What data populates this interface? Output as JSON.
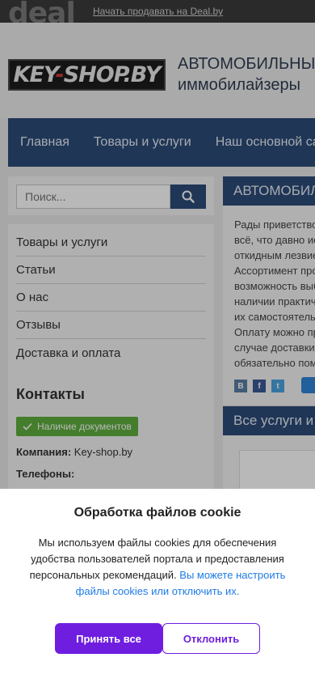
{
  "topbar": {
    "logo": "deal",
    "sell_link": "Начать продавать на Deal.by"
  },
  "header": {
    "logo_part1": "KEY",
    "logo_dash": "-",
    "logo_part2": "SHOP.BY",
    "tagline_line1": "АВТОМОБИЛЬНЫ",
    "tagline_line2": "иммобилайзеры"
  },
  "nav": [
    "Главная",
    "Товары и услуги",
    "Наш основной са"
  ],
  "search": {
    "placeholder": "Поиск...",
    "icon": "search-icon"
  },
  "menu": [
    "Товары и услуги",
    "Статьи",
    "О нас",
    "Отзывы",
    "Доставка и оплата"
  ],
  "contacts": {
    "title": "Контакты",
    "docs_badge": "Наличие документов",
    "company_label": "Компания:",
    "company_value": "Key-shop.by",
    "phones_label": "Телефоны:"
  },
  "main": {
    "heading": "АВТОМОБИЛ",
    "lines": [
      "Рады приветство",
      "всё, что давно ис",
      "откидным лезвие",
      "Ассортимент про",
      "возможность выб",
      "наличии практич",
      "их самостоятель",
      "Оплату можно пр",
      "случае доставки",
      "обязательно пом"
    ],
    "share": [
      "В",
      "f",
      "t"
    ]
  },
  "services": {
    "heading": "Все услуги и"
  },
  "cookie": {
    "title": "Обработка файлов cookie",
    "text": "Мы используем файлы cookies для обеспечения удобства пользователей портала и предоставления персональных рекомендаций.",
    "link": "Вы можете настроить файлы cookies или отключить их.",
    "accept": "Принять все",
    "reject": "Отклонить"
  },
  "colors": {
    "nav_bg": "#2d4b78",
    "accept_bg": "#6f1ee0",
    "badge_bg": "#5fae3e",
    "link": "#1e7be6"
  }
}
